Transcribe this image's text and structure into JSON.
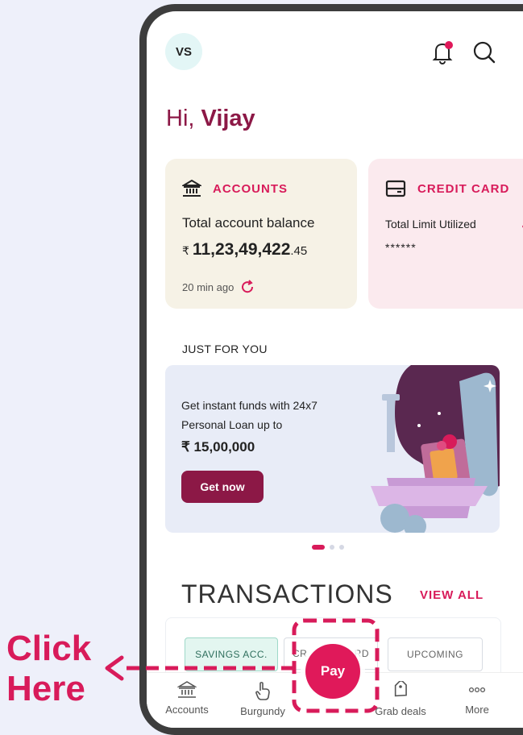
{
  "header": {
    "avatar_initials": "VS",
    "notification_dot_color": "#e0195a"
  },
  "greeting": {
    "prefix": "Hi, ",
    "name": "Vijay"
  },
  "accounts_card": {
    "title": "ACCOUNTS",
    "label": "Total account balance",
    "currency": "₹",
    "amount_main": "11,23,49,422",
    "amount_decimal": ".45",
    "updated": "20 min ago"
  },
  "credit_card": {
    "title": "CREDIT CARD",
    "label": "Total Limit Utilized",
    "masked_value": "******"
  },
  "promo": {
    "section_label": "JUST FOR YOU",
    "text": "Get instant funds with 24x7 Personal Loan up to",
    "amount": "₹ 15,00,000",
    "button_label": "Get now",
    "page_dots": 3,
    "active_dot": 1
  },
  "transactions": {
    "title": "TRANSACTIONS",
    "view_all": "VIEW ALL",
    "chips": [
      {
        "label": "SAVINGS ACC.",
        "active": true
      },
      {
        "label": "CREDIT CARD",
        "active": false
      },
      {
        "label": "UPCOMING",
        "active": false
      }
    ],
    "chip_partial_left": "CR",
    "chip_partial_right": "RD"
  },
  "bottom_nav": {
    "items": [
      {
        "label": "Accounts",
        "icon": "bank-icon"
      },
      {
        "label": "Burgundy",
        "icon": "pointer-hand-icon"
      },
      {
        "label": "Grab deals",
        "icon": "tag-icon"
      },
      {
        "label": "More",
        "icon": "more-dots-icon"
      }
    ],
    "pay_label": "Pay"
  },
  "annotation": {
    "text_line1": "Click",
    "text_line2": "Here"
  },
  "colors": {
    "accent": "#d81b5a",
    "brand_dark": "#8c1846",
    "accounts_card_bg": "#f6f2e6",
    "credit_card_bg": "#fbeaee"
  }
}
